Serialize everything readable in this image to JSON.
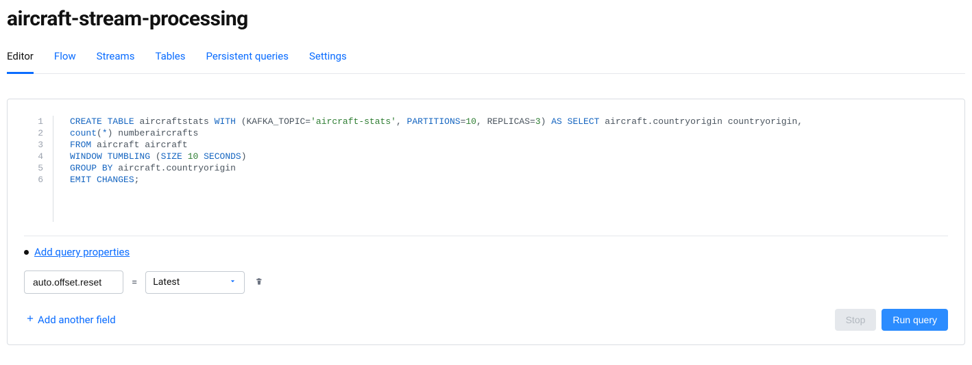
{
  "header": {
    "title": "aircraft-stream-processing"
  },
  "tabs": [
    {
      "id": "editor",
      "label": "Editor",
      "active": true
    },
    {
      "id": "flow",
      "label": "Flow"
    },
    {
      "id": "streams",
      "label": "Streams"
    },
    {
      "id": "tables",
      "label": "Tables"
    },
    {
      "id": "pq",
      "label": "Persistent queries"
    },
    {
      "id": "settings",
      "label": "Settings"
    }
  ],
  "code": {
    "gutter": [
      "1",
      "2",
      "3",
      "4",
      "5",
      "6"
    ],
    "line1": {
      "t1": "CREATE",
      "t2": "TABLE",
      "t3": " aircraftstats ",
      "t4": "WITH",
      "t5": " (KAFKA_TOPIC=",
      "t6": "'aircraft-stats'",
      "t7": ", ",
      "t8": "PARTITIONS",
      "t9": "=",
      "t10": "10",
      "t11": ", REPLICAS=",
      "t12": "3",
      "t13": ") ",
      "t14": "AS",
      "t15": "SELECT",
      "t16": " aircraft.countryorigin countryorigin,"
    },
    "line2": {
      "t1": "count",
      "t2": "(",
      "t3": "*",
      "t4": ") numberaircrafts"
    },
    "line3": {
      "t1": "FROM",
      "t2": " aircraft aircraft"
    },
    "line4": {
      "t1": "WINDOW",
      "t2": "TUMBLING",
      "t3": " (",
      "t4": "SIZE",
      "t5": " ",
      "t6": "10",
      "t7": " ",
      "t8": "SECONDS",
      "t9": ")"
    },
    "line5": {
      "t1": "GROUP",
      "t2": "BY",
      "t3": " aircraft.countryorigin"
    },
    "line6": {
      "t1": "EMIT",
      "t2": "CHANGES",
      "t3": ";"
    }
  },
  "props": {
    "link": "Add query properties",
    "key": "auto.offset.reset",
    "eq": "=",
    "value": "Latest",
    "addAnother": "Add another field"
  },
  "actions": {
    "stop": "Stop",
    "run": "Run query"
  }
}
